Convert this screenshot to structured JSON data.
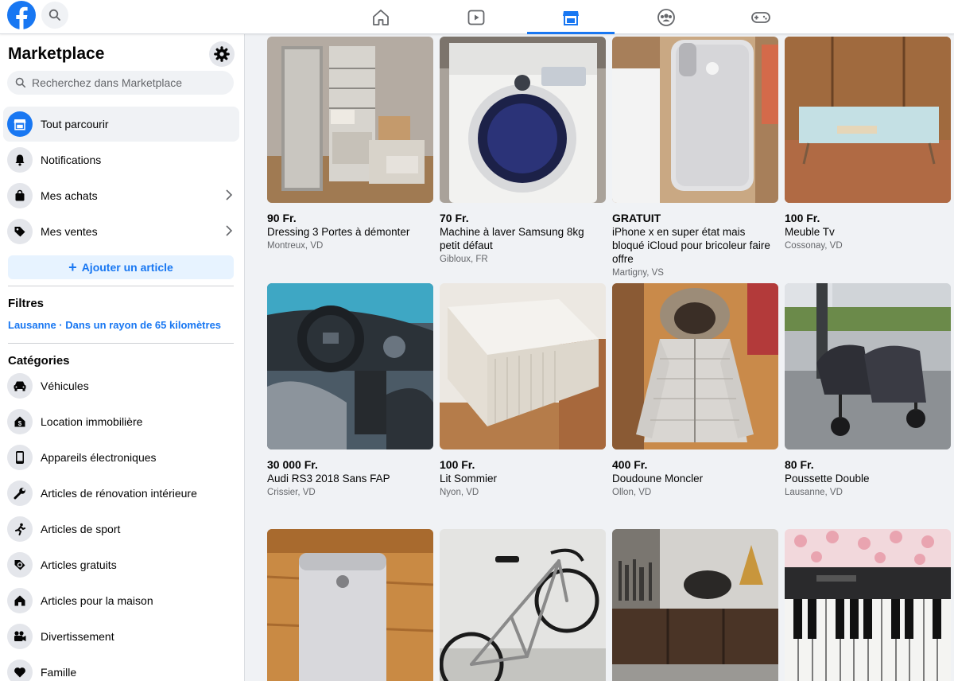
{
  "topbar": {
    "tabs": [
      {
        "icon": "home-icon"
      },
      {
        "icon": "watch-icon"
      },
      {
        "icon": "marketplace-icon",
        "active": true
      },
      {
        "icon": "groups-icon"
      },
      {
        "icon": "gaming-icon"
      }
    ]
  },
  "sidebar": {
    "title": "Marketplace",
    "search_placeholder": "Recherchez dans Marketplace",
    "nav": [
      {
        "label": "Tout parcourir",
        "icon": "storefront-icon",
        "active": true
      },
      {
        "label": "Notifications",
        "icon": "bell-icon"
      },
      {
        "label": "Mes achats",
        "icon": "shopping-bag-icon"
      },
      {
        "label": "Mes ventes",
        "icon": "price-tag-icon"
      }
    ],
    "add_label": "Ajouter un article",
    "filters_title": "Filtres",
    "location": "Lausanne · Dans un rayon de 65 kilomètres",
    "categories_title": "Catégories",
    "categories": [
      {
        "label": "Véhicules",
        "icon": "car-icon"
      },
      {
        "label": "Location immobilière",
        "icon": "house-dollar-icon"
      },
      {
        "label": "Appareils électroniques",
        "icon": "phone-icon"
      },
      {
        "label": "Articles de rénovation intérieure",
        "icon": "wrench-icon"
      },
      {
        "label": "Articles de sport",
        "icon": "runner-icon"
      },
      {
        "label": "Articles gratuits",
        "icon": "free-tag-icon"
      },
      {
        "label": "Articles pour la maison",
        "icon": "home-icon"
      },
      {
        "label": "Divertissement",
        "icon": "camera-icon"
      },
      {
        "label": "Famille",
        "icon": "heart-icon"
      }
    ]
  },
  "listings": [
    {
      "price": "90 Fr.",
      "title": "Dressing 3 Portes à démonter",
      "location": "Montreux, VD"
    },
    {
      "price": "70 Fr.",
      "title": "Machine à laver Samsung 8kg petit défaut",
      "location": "Gibloux, FR"
    },
    {
      "price": "GRATUIT",
      "title": "iPhone x en super état mais bloqué iCloud pour bricoleur faire offre",
      "location": "Martigny, VS"
    },
    {
      "price": "100 Fr.",
      "title": "Meuble Tv",
      "location": "Cossonay, VD"
    },
    {
      "price": "30 000 Fr.",
      "title": "Audi RS3 2018 Sans FAP",
      "location": "Crissier, VD"
    },
    {
      "price": "100 Fr.",
      "title": "Lit Sommier",
      "location": "Nyon, VD"
    },
    {
      "price": "400 Fr.",
      "title": "Doudoune Moncler",
      "location": "Ollon, VD"
    },
    {
      "price": "80 Fr.",
      "title": "Poussette Double",
      "location": "Lausanne, VD"
    },
    {
      "price": "",
      "title": "",
      "location": ""
    },
    {
      "price": "",
      "title": "",
      "location": ""
    },
    {
      "price": "",
      "title": "",
      "location": ""
    },
    {
      "price": "",
      "title": "",
      "location": ""
    }
  ],
  "colors": {
    "accent": "#1877f2",
    "background": "#f0f2f5",
    "secondary_text": "#65676b"
  }
}
